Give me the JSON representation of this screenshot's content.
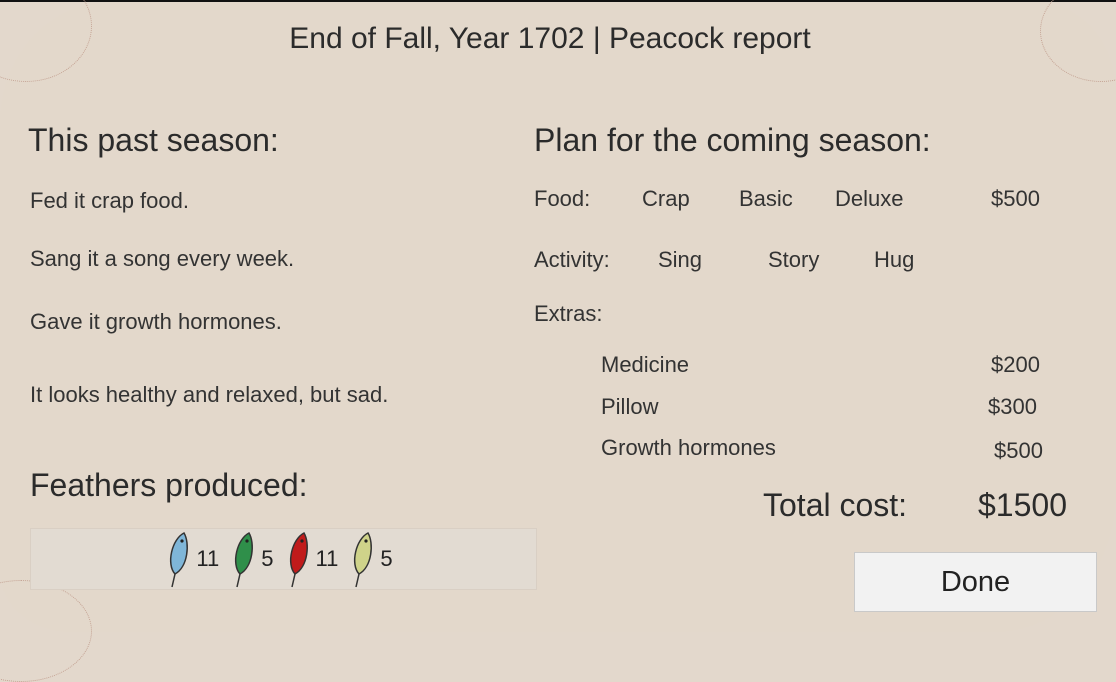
{
  "report": {
    "title": "End of Fall, Year 1702 | Peacock report"
  },
  "past_season": {
    "heading": "This past season:",
    "lines": [
      "Fed it crap food.",
      "Sang it a song every week.",
      "Gave it growth hormones.",
      "It looks healthy and relaxed, but sad."
    ]
  },
  "feathers": {
    "heading": "Feathers produced:",
    "items": [
      {
        "color": "#7fb6d8",
        "count": "11",
        "icon": "blue-feather"
      },
      {
        "color": "#2f8f4a",
        "count": "5",
        "icon": "green-feather"
      },
      {
        "color": "#c01b1b",
        "count": "11",
        "icon": "red-feather"
      },
      {
        "color": "#cfd38a",
        "count": "5",
        "icon": "yellow-feather"
      }
    ]
  },
  "plan": {
    "heading": "Plan for the coming season:",
    "food": {
      "label": "Food:",
      "options": [
        "Crap",
        "Basic",
        "Deluxe"
      ],
      "price": "$500"
    },
    "activity": {
      "label": "Activity:",
      "options": [
        "Sing",
        "Story",
        "Hug"
      ]
    },
    "extras": {
      "label": "Extras:",
      "items": [
        {
          "name": "Medicine",
          "price": "$200"
        },
        {
          "name": "Pillow",
          "price": "$300"
        },
        {
          "name": "Growth hormones",
          "price": "$500"
        }
      ]
    },
    "total_label": "Total cost:",
    "total_value": "$1500"
  },
  "done_label": "Done"
}
